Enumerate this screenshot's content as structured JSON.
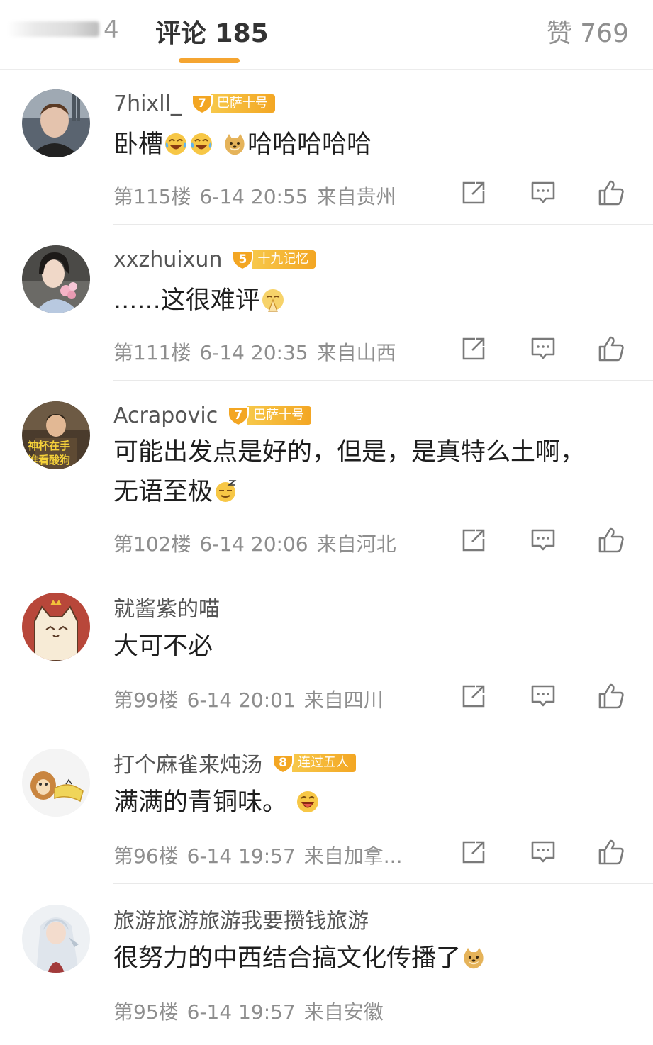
{
  "header": {
    "left_tab_digit": "4",
    "comments_tab": "评论 185",
    "likes_tab": "赞 769"
  },
  "comments": [
    {
      "username": "7hixll_",
      "level": "7",
      "tag": "巴萨十号",
      "text_before": "卧槽",
      "text_after": "哈哈哈哈哈",
      "floor": "第115楼",
      "time": "6-14 20:55",
      "location": "来自贵州"
    },
    {
      "username": "xxzhuixun",
      "level": "5",
      "tag": "十九记忆",
      "text": "......这很难评",
      "floor": "第111楼",
      "time": "6-14 20:35",
      "location": "来自山西"
    },
    {
      "username": "Acrapovic",
      "level": "7",
      "tag": "巴萨十号",
      "avatar_text_1": "神杯在手",
      "avatar_text_2": "谁看酸狗",
      "text_line1": "可能出发点是好的，但是，是真特么土啊，",
      "text_line2": "无语至极",
      "floor": "第102楼",
      "time": "6-14 20:06",
      "location": "来自河北"
    },
    {
      "username": "就酱紫的喵",
      "text": "大可不必",
      "floor": "第99楼",
      "time": "6-14 20:01",
      "location": "来自四川"
    },
    {
      "username": "打个麻雀来炖汤",
      "level": "8",
      "tag": "连过五人",
      "text": "满满的青铜味。",
      "floor": "第96楼",
      "time": "6-14 19:57",
      "location": "来自加拿..."
    },
    {
      "username": "旅游旅游旅游我要攒钱旅游",
      "text": "很努力的中西结合搞文化传播了",
      "floor": "第95楼",
      "time": "6-14 19:57",
      "location": "来自安徽"
    }
  ],
  "icons": {
    "share": "share-icon",
    "reply": "comment-icon",
    "like": "thumbs-up-icon"
  },
  "colors": {
    "accent": "#f5a531",
    "badge_gold": "#f3a623",
    "meta_gray": "#8e8e8e"
  }
}
